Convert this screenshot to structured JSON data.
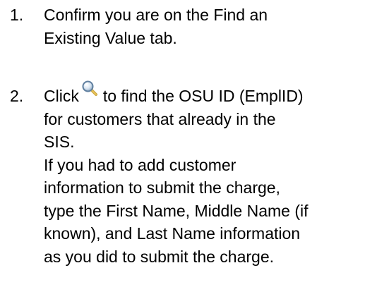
{
  "steps": [
    {
      "number": "1.",
      "lines": [
        "Confirm you are on the Find an",
        "Existing Value tab."
      ]
    },
    {
      "number": "2.",
      "click_word": "Click",
      "icon": "magnifying-glass-icon",
      "line1_rest": "to find the OSU ID (EmplID)",
      "lines": [
        "for customers that already in the",
        "SIS.",
        "If you had to add customer",
        "information to submit the charge,",
        "type the First Name, Middle Name (if",
        "known), and Last Name information",
        "as you did to submit the charge."
      ]
    }
  ]
}
